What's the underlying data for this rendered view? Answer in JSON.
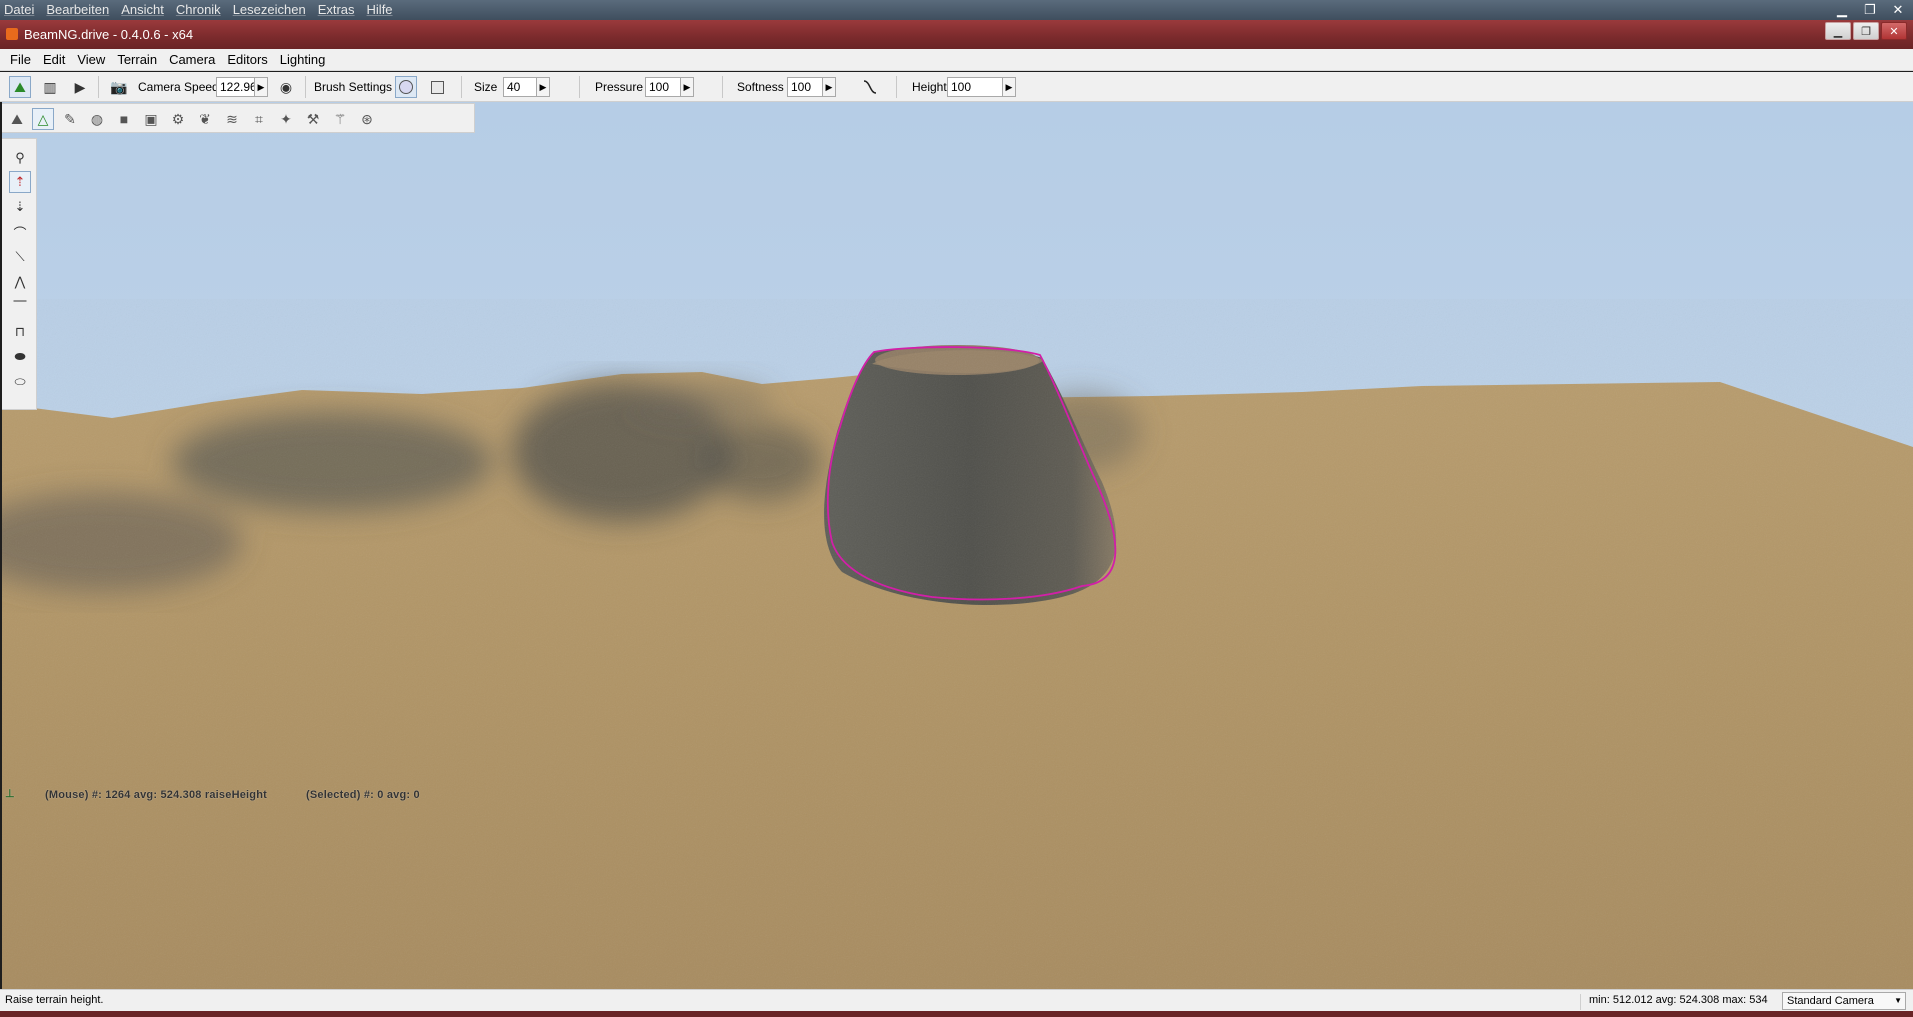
{
  "browser_menu": [
    "Datei",
    "Bearbeiten",
    "Ansicht",
    "Chronik",
    "Lesezeichen",
    "Extras",
    "Hilfe"
  ],
  "window": {
    "title": "BeamNG.drive - 0.4.0.6 - x64"
  },
  "app_menu": [
    "File",
    "Edit",
    "View",
    "Terrain",
    "Camera",
    "Editors",
    "Lighting"
  ],
  "toolbar": {
    "camera_speed_label": "Camera Speed",
    "camera_speed_value": "122.96",
    "brush_settings_label": "Brush Settings",
    "size_label": "Size",
    "size_value": "40",
    "pressure_label": "Pressure",
    "pressure_value": "100",
    "softness_label": "Softness",
    "softness_value": "100",
    "height_label": "Height",
    "height_value": "100"
  },
  "viewport": {
    "mouse_info": "(Mouse) #: 1264  avg: 524.308 raiseHeight",
    "selected_info": "(Selected) #: 0  avg: 0"
  },
  "statusbar": {
    "message": "Raise terrain height.",
    "stats": "min: 512.012  avg: 524.308  max: 534",
    "camera_mode": "Standard Camera"
  },
  "colors": {
    "brush_outline": "#d21fa8",
    "titlebar": "#7b2a2c",
    "sky": "#bcd2e8",
    "terrain": "#b59a6c"
  }
}
